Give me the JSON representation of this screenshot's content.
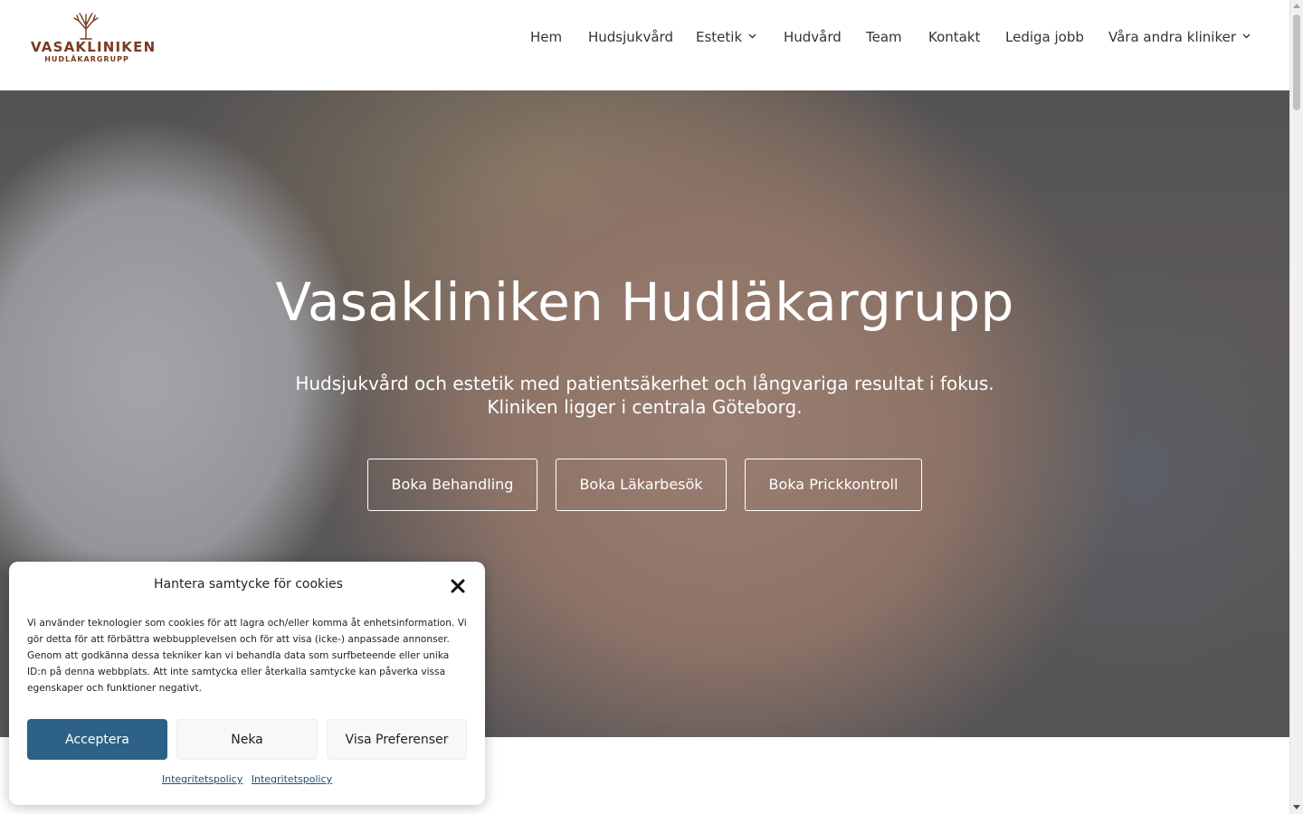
{
  "brand": {
    "name": "VASAKLINIKEN",
    "subtitle": "HUDLÄKARGRUPP",
    "color": "#7a3a22"
  },
  "nav": {
    "items": [
      {
        "label": "Hem"
      },
      {
        "label": "Hudsjukvård"
      },
      {
        "label": "Estetik",
        "has_dropdown": true
      },
      {
        "label": "Hudvård"
      },
      {
        "label": "Team"
      },
      {
        "label": "Kontakt"
      },
      {
        "label": "Lediga jobb"
      },
      {
        "label": "Våra andra kliniker",
        "has_dropdown": true
      }
    ]
  },
  "hero": {
    "title": "Vasakliniken Hudläkargrupp",
    "subtitle_line1": "Hudsjukvård och estetik med patientsäkerhet och långvariga resultat i fokus.",
    "subtitle_line2": "Kliniken ligger i centrala Göteborg.",
    "buttons": [
      {
        "label": "Boka Behandling"
      },
      {
        "label": "Boka Läkarbesök"
      },
      {
        "label": "Boka Prickkontroll"
      }
    ]
  },
  "cookie_modal": {
    "title": "Hantera samtycke för cookies",
    "close_icon": "close-icon",
    "body": "Vi använder teknologier som cookies för att lagra och/eller komma åt enhetsinformation. Vi gör detta för att förbättra webbupplevelsen och för att visa (icke-) anpassade annonser. Genom att godkänna dessa tekniker kan vi behandla data som surfbeteende eller unika ID:n på denna webbplats. Att inte samtycka eller återkalla samtycke kan påverka vissa egenskaper och funktioner negativt.",
    "accept_label": "Acceptera",
    "deny_label": "Neka",
    "preferences_label": "Visa Preferenser",
    "links": [
      "Integritetspolicy",
      "Integritetspolicy"
    ],
    "accent_color": "#2d6185"
  }
}
